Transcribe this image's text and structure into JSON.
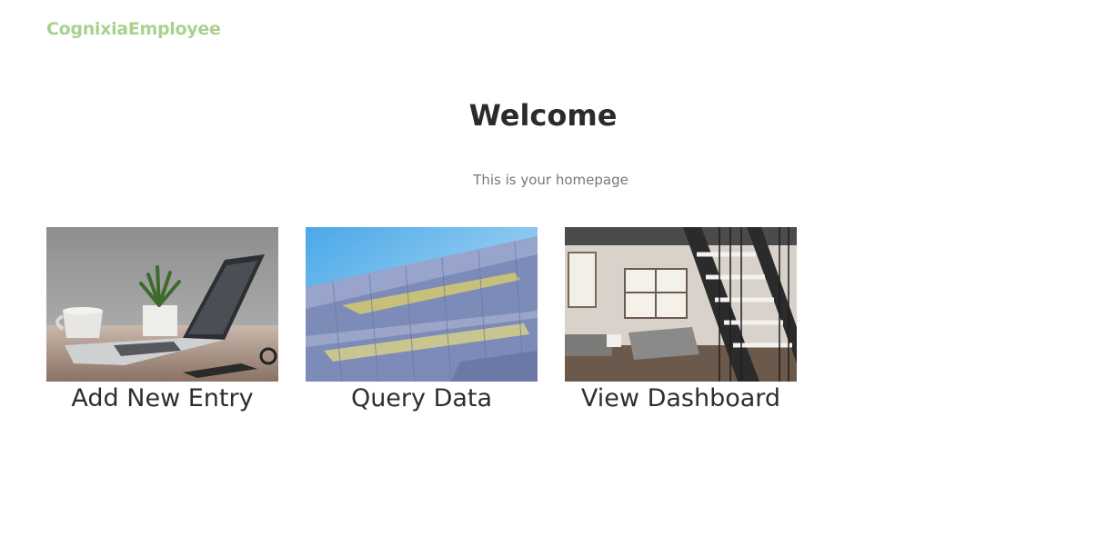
{
  "navbar": {
    "brand": "CognixiaEmployee"
  },
  "hero": {
    "title": "Welcome",
    "subtitle": "This is your homepage"
  },
  "cards": [
    {
      "label": "Add New Entry",
      "image": "laptop-desk-photo"
    },
    {
      "label": "Query Data",
      "image": "modern-building-facade-photo"
    },
    {
      "label": "View Dashboard",
      "image": "loft-interior-stairs-photo"
    }
  ],
  "colors": {
    "brand": "#a9d18e",
    "text": "#2e2e2e",
    "muted": "#777777"
  }
}
